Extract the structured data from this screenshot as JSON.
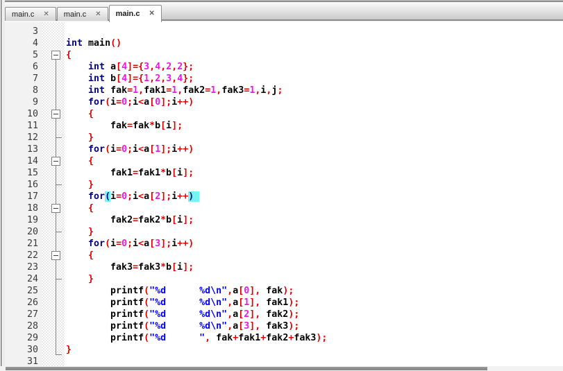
{
  "tab_bar": {
    "close_icon": "✕",
    "tabs": [
      {
        "label": "main.c",
        "active": false
      },
      {
        "label": "main.c",
        "active": false
      },
      {
        "label": "main.c",
        "active": true
      }
    ]
  },
  "editor": {
    "first_line": 3,
    "last_line": 31,
    "language": "c",
    "fold": {
      "line_from": 5,
      "boxes": [
        5,
        10,
        14,
        18,
        22
      ],
      "ticks": [
        12,
        16,
        20,
        24
      ],
      "corner_line": 30
    },
    "lines": [
      {
        "n": 3,
        "t": []
      },
      {
        "n": 4,
        "t": [
          [
            "k",
            "int"
          ],
          [
            "p",
            " "
          ],
          [
            "i",
            "main"
          ],
          [
            "o",
            "()"
          ]
        ]
      },
      {
        "n": 5,
        "t": [
          [
            "o",
            "{"
          ]
        ]
      },
      {
        "n": 6,
        "t": [
          [
            "p",
            "    "
          ],
          [
            "k",
            "int"
          ],
          [
            "p",
            " "
          ],
          [
            "i",
            "a"
          ],
          [
            "o",
            "["
          ],
          [
            "n",
            "4"
          ],
          [
            "o",
            "]={"
          ],
          [
            "n",
            "3"
          ],
          [
            "o",
            ","
          ],
          [
            "n",
            "4"
          ],
          [
            "o",
            ","
          ],
          [
            "n",
            "2"
          ],
          [
            "o",
            ","
          ],
          [
            "n",
            "2"
          ],
          [
            "o",
            "};"
          ]
        ]
      },
      {
        "n": 7,
        "t": [
          [
            "p",
            "    "
          ],
          [
            "k",
            "int"
          ],
          [
            "p",
            " "
          ],
          [
            "i",
            "b"
          ],
          [
            "o",
            "["
          ],
          [
            "n",
            "4"
          ],
          [
            "o",
            "]={"
          ],
          [
            "n",
            "1"
          ],
          [
            "o",
            ","
          ],
          [
            "n",
            "2"
          ],
          [
            "o",
            ","
          ],
          [
            "n",
            "3"
          ],
          [
            "o",
            ","
          ],
          [
            "n",
            "4"
          ],
          [
            "o",
            "};"
          ]
        ]
      },
      {
        "n": 8,
        "t": [
          [
            "p",
            "    "
          ],
          [
            "k",
            "int"
          ],
          [
            "p",
            " "
          ],
          [
            "i",
            "fak"
          ],
          [
            "o",
            "="
          ],
          [
            "n",
            "1"
          ],
          [
            "o",
            ","
          ],
          [
            "i",
            "fak1"
          ],
          [
            "o",
            "="
          ],
          [
            "n",
            "1"
          ],
          [
            "o",
            ","
          ],
          [
            "i",
            "fak2"
          ],
          [
            "o",
            "="
          ],
          [
            "n",
            "1"
          ],
          [
            "o",
            ","
          ],
          [
            "i",
            "fak3"
          ],
          [
            "o",
            "="
          ],
          [
            "n",
            "1"
          ],
          [
            "o",
            ","
          ],
          [
            "i",
            "i"
          ],
          [
            "o",
            ","
          ],
          [
            "i",
            "j"
          ],
          [
            "o",
            ";"
          ]
        ]
      },
      {
        "n": 9,
        "t": [
          [
            "p",
            "    "
          ],
          [
            "k",
            "for"
          ],
          [
            "o",
            "("
          ],
          [
            "i",
            "i"
          ],
          [
            "o",
            "="
          ],
          [
            "n",
            "0"
          ],
          [
            "o",
            ";"
          ],
          [
            "i",
            "i"
          ],
          [
            "o",
            "<"
          ],
          [
            "i",
            "a"
          ],
          [
            "o",
            "["
          ],
          [
            "n",
            "0"
          ],
          [
            "o",
            "];"
          ],
          [
            "i",
            "i"
          ],
          [
            "o",
            "++)"
          ]
        ]
      },
      {
        "n": 10,
        "t": [
          [
            "p",
            "    "
          ],
          [
            "o",
            "{"
          ]
        ]
      },
      {
        "n": 11,
        "t": [
          [
            "p",
            "        "
          ],
          [
            "i",
            "fak"
          ],
          [
            "o",
            "="
          ],
          [
            "i",
            "fak"
          ],
          [
            "o",
            "*"
          ],
          [
            "i",
            "b"
          ],
          [
            "o",
            "["
          ],
          [
            "i",
            "i"
          ],
          [
            "o",
            "];"
          ]
        ]
      },
      {
        "n": 12,
        "t": [
          [
            "p",
            "    "
          ],
          [
            "o",
            "}"
          ]
        ]
      },
      {
        "n": 13,
        "t": [
          [
            "p",
            "    "
          ],
          [
            "k",
            "for"
          ],
          [
            "o",
            "("
          ],
          [
            "i",
            "i"
          ],
          [
            "o",
            "="
          ],
          [
            "n",
            "0"
          ],
          [
            "o",
            ";"
          ],
          [
            "i",
            "i"
          ],
          [
            "o",
            "<"
          ],
          [
            "i",
            "a"
          ],
          [
            "o",
            "["
          ],
          [
            "n",
            "1"
          ],
          [
            "o",
            "];"
          ],
          [
            "i",
            "i"
          ],
          [
            "o",
            "++)"
          ]
        ]
      },
      {
        "n": 14,
        "t": [
          [
            "p",
            "    "
          ],
          [
            "o",
            "{"
          ]
        ]
      },
      {
        "n": 15,
        "t": [
          [
            "p",
            "        "
          ],
          [
            "i",
            "fak1"
          ],
          [
            "o",
            "="
          ],
          [
            "i",
            "fak1"
          ],
          [
            "o",
            "*"
          ],
          [
            "i",
            "b"
          ],
          [
            "o",
            "["
          ],
          [
            "i",
            "i"
          ],
          [
            "o",
            "];"
          ]
        ]
      },
      {
        "n": 16,
        "t": [
          [
            "p",
            "    "
          ],
          [
            "o",
            "}"
          ]
        ]
      },
      {
        "n": 17,
        "t": [
          [
            "p",
            "    "
          ],
          [
            "k",
            "for"
          ],
          [
            "h",
            "("
          ],
          [
            "i",
            "i"
          ],
          [
            "o",
            "="
          ],
          [
            "n",
            "0"
          ],
          [
            "o",
            ";"
          ],
          [
            "i",
            "i"
          ],
          [
            "o",
            "<"
          ],
          [
            "i",
            "a"
          ],
          [
            "o",
            "["
          ],
          [
            "n",
            "2"
          ],
          [
            "o",
            "];"
          ],
          [
            "i",
            "i"
          ],
          [
            "o",
            "++"
          ],
          [
            "h",
            ")"
          ],
          [
            "hs",
            " "
          ]
        ]
      },
      {
        "n": 18,
        "t": [
          [
            "p",
            "    "
          ],
          [
            "o",
            "{"
          ]
        ]
      },
      {
        "n": 19,
        "t": [
          [
            "p",
            "        "
          ],
          [
            "i",
            "fak2"
          ],
          [
            "o",
            "="
          ],
          [
            "i",
            "fak2"
          ],
          [
            "o",
            "*"
          ],
          [
            "i",
            "b"
          ],
          [
            "o",
            "["
          ],
          [
            "i",
            "i"
          ],
          [
            "o",
            "];"
          ]
        ]
      },
      {
        "n": 20,
        "t": [
          [
            "p",
            "    "
          ],
          [
            "o",
            "}"
          ]
        ]
      },
      {
        "n": 21,
        "t": [
          [
            "p",
            "    "
          ],
          [
            "k",
            "for"
          ],
          [
            "o",
            "("
          ],
          [
            "i",
            "i"
          ],
          [
            "o",
            "="
          ],
          [
            "n",
            "0"
          ],
          [
            "o",
            ";"
          ],
          [
            "i",
            "i"
          ],
          [
            "o",
            "<"
          ],
          [
            "i",
            "a"
          ],
          [
            "o",
            "["
          ],
          [
            "n",
            "3"
          ],
          [
            "o",
            "];"
          ],
          [
            "i",
            "i"
          ],
          [
            "o",
            "++)"
          ]
        ]
      },
      {
        "n": 22,
        "t": [
          [
            "p",
            "    "
          ],
          [
            "o",
            "{"
          ]
        ]
      },
      {
        "n": 23,
        "t": [
          [
            "p",
            "        "
          ],
          [
            "i",
            "fak3"
          ],
          [
            "o",
            "="
          ],
          [
            "i",
            "fak3"
          ],
          [
            "o",
            "*"
          ],
          [
            "i",
            "b"
          ],
          [
            "o",
            "["
          ],
          [
            "i",
            "i"
          ],
          [
            "o",
            "];"
          ]
        ]
      },
      {
        "n": 24,
        "t": [
          [
            "p",
            "    "
          ],
          [
            "o",
            "}"
          ]
        ]
      },
      {
        "n": 25,
        "t": [
          [
            "p",
            "        "
          ],
          [
            "i",
            "printf"
          ],
          [
            "o",
            "("
          ],
          [
            "s",
            "\"%d      %d\\n\""
          ],
          [
            "o",
            ","
          ],
          [
            "i",
            "a"
          ],
          [
            "o",
            "["
          ],
          [
            "n",
            "0"
          ],
          [
            "o",
            "],"
          ],
          [
            "p",
            " "
          ],
          [
            "i",
            "fak"
          ],
          [
            "o",
            ");"
          ]
        ]
      },
      {
        "n": 26,
        "t": [
          [
            "p",
            "        "
          ],
          [
            "i",
            "printf"
          ],
          [
            "o",
            "("
          ],
          [
            "s",
            "\"%d      %d\\n\""
          ],
          [
            "o",
            ","
          ],
          [
            "i",
            "a"
          ],
          [
            "o",
            "["
          ],
          [
            "n",
            "1"
          ],
          [
            "o",
            "],"
          ],
          [
            "p",
            " "
          ],
          [
            "i",
            "fak1"
          ],
          [
            "o",
            ");"
          ]
        ]
      },
      {
        "n": 27,
        "t": [
          [
            "p",
            "        "
          ],
          [
            "i",
            "printf"
          ],
          [
            "o",
            "("
          ],
          [
            "s",
            "\"%d      %d\\n\""
          ],
          [
            "o",
            ","
          ],
          [
            "i",
            "a"
          ],
          [
            "o",
            "["
          ],
          [
            "n",
            "2"
          ],
          [
            "o",
            "],"
          ],
          [
            "p",
            " "
          ],
          [
            "i",
            "fak2"
          ],
          [
            "o",
            ");"
          ]
        ]
      },
      {
        "n": 28,
        "t": [
          [
            "p",
            "        "
          ],
          [
            "i",
            "printf"
          ],
          [
            "o",
            "("
          ],
          [
            "s",
            "\"%d      %d\\n\""
          ],
          [
            "o",
            ","
          ],
          [
            "i",
            "a"
          ],
          [
            "o",
            "["
          ],
          [
            "n",
            "3"
          ],
          [
            "o",
            "],"
          ],
          [
            "p",
            " "
          ],
          [
            "i",
            "fak3"
          ],
          [
            "o",
            ");"
          ]
        ]
      },
      {
        "n": 29,
        "t": [
          [
            "p",
            "        "
          ],
          [
            "i",
            "printf"
          ],
          [
            "o",
            "("
          ],
          [
            "s",
            "\"%d      \""
          ],
          [
            "o",
            ","
          ],
          [
            "p",
            " "
          ],
          [
            "i",
            "fak"
          ],
          [
            "o",
            "+"
          ],
          [
            "i",
            "fak1"
          ],
          [
            "o",
            "+"
          ],
          [
            "i",
            "fak2"
          ],
          [
            "o",
            "+"
          ],
          [
            "i",
            "fak3"
          ],
          [
            "o",
            ");"
          ]
        ]
      },
      {
        "n": 30,
        "t": [
          [
            "o",
            "}"
          ]
        ]
      },
      {
        "n": 31,
        "t": []
      }
    ]
  },
  "colors": {
    "keyword": "#000080",
    "identifier": "#000000",
    "operator": "#dc0000",
    "number": "#e519e5",
    "string": "#0000ee",
    "brace_match_bg": "#76f5f5",
    "gutter_bg": "#f2f2f2",
    "fold_line": "#838383"
  }
}
